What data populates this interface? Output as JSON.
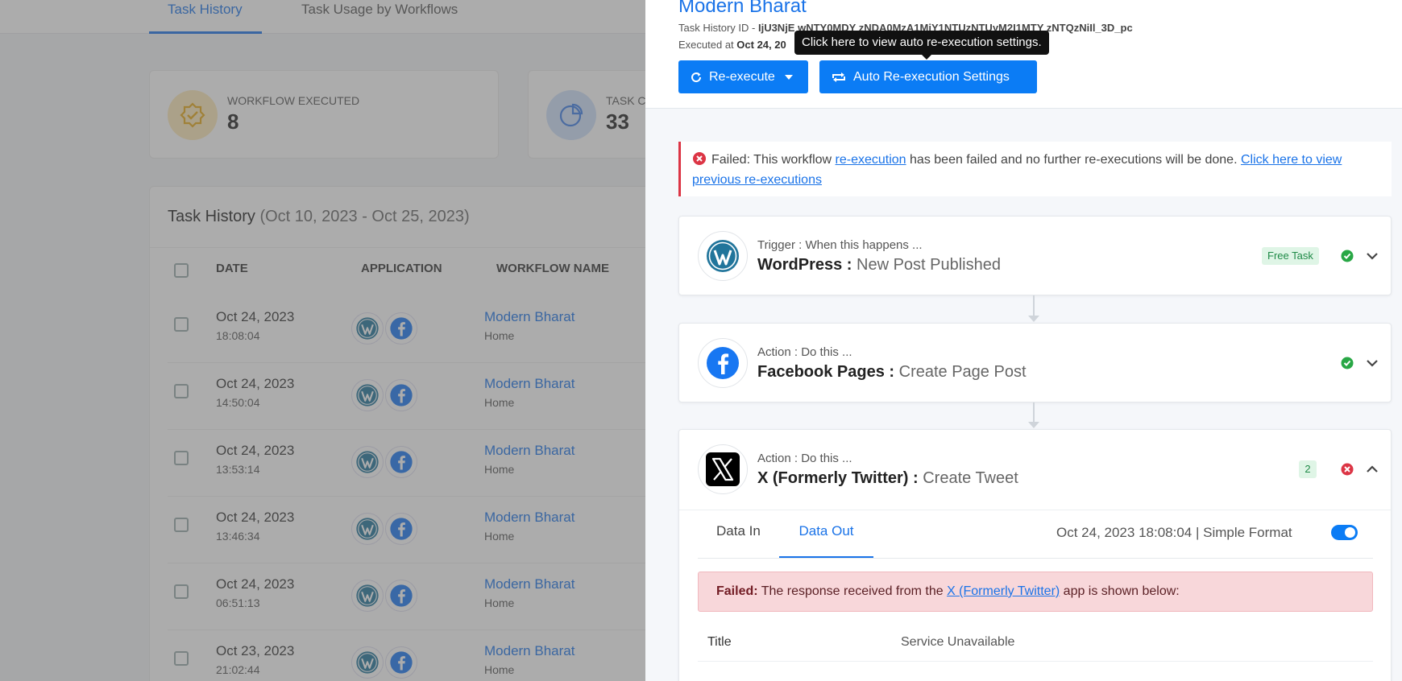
{
  "background": {
    "tabs": [
      "Task History",
      "Task Usage by Workflows"
    ],
    "stats": [
      {
        "label": "WORKFLOW EXECUTED",
        "value": "8"
      },
      {
        "label": "TASK CO",
        "value": "33"
      }
    ],
    "history": {
      "title": "Task History",
      "range": "(Oct 10, 2023 - Oct 25, 2023)",
      "columns": [
        "DATE",
        "APPLICATION",
        "WORKFLOW NAME"
      ],
      "rows": [
        {
          "date": "Oct 24, 2023",
          "time": "18:08:04",
          "workflow": "Modern Bharat",
          "folder": "Home"
        },
        {
          "date": "Oct 24, 2023",
          "time": "14:50:04",
          "workflow": "Modern Bharat",
          "folder": "Home"
        },
        {
          "date": "Oct 24, 2023",
          "time": "13:53:14",
          "workflow": "Modern Bharat",
          "folder": "Home"
        },
        {
          "date": "Oct 24, 2023",
          "time": "13:46:34",
          "workflow": "Modern Bharat",
          "folder": "Home"
        },
        {
          "date": "Oct 24, 2023",
          "time": "06:51:13",
          "workflow": "Modern Bharat",
          "folder": "Home"
        },
        {
          "date": "Oct 23, 2023",
          "time": "21:02:44",
          "workflow": "Modern Bharat",
          "folder": "Home"
        }
      ]
    }
  },
  "panel": {
    "title": "Modern Bharat",
    "task_id_label": "Task History ID - ",
    "task_id_value": "IjU3NjE wNTY0MDY zNDA0MzA1MjY1NTUzNTUyM2I1MTY zNTQzNiIl_3D_pc",
    "executed_label": "Executed at ",
    "executed_value": "Oct 24, 20",
    "reexecute_label": "Re-execute",
    "auto_label": "Auto Re-execution Settings",
    "tooltip": "Click here to view auto re-execution settings.",
    "alert": {
      "prefix": "Failed: This workflow ",
      "link1": "re-execution",
      "middle": " has been failed and no further re-executions will be done. ",
      "link2": "Click here to view previous re-executions"
    },
    "steps": [
      {
        "kind": "Trigger : When this happens ...",
        "app": "WordPress : ",
        "event": "New Post Published",
        "badge": "Free Task",
        "status": "success",
        "icon": "wordpress-logo"
      },
      {
        "kind": "Action : Do this ...",
        "app": "Facebook Pages : ",
        "event": "Create Page Post",
        "status": "success",
        "icon": "facebook-logo"
      },
      {
        "kind": "Action : Do this ...",
        "app": "X (Formerly Twitter) : ",
        "event": "Create Tweet",
        "badge": "2",
        "status": "failed",
        "icon": "x-logo"
      }
    ],
    "detail": {
      "tab_in": "Data In",
      "tab_out": "Data Out",
      "exec_time": "Oct 24, 2023 18:08:04  |  Simple Format",
      "simple_format_on": true,
      "fail_bold": "Failed:",
      "fail_prefix": " The response received from the ",
      "fail_link": "X (Formerly Twitter)",
      "fail_suffix": " app is shown below:",
      "result_key": "Title",
      "result_value": "Service Unavailable"
    },
    "colors": {
      "primary": "#0b7cf5",
      "danger": "#dc3545",
      "success": "#28a745"
    }
  }
}
